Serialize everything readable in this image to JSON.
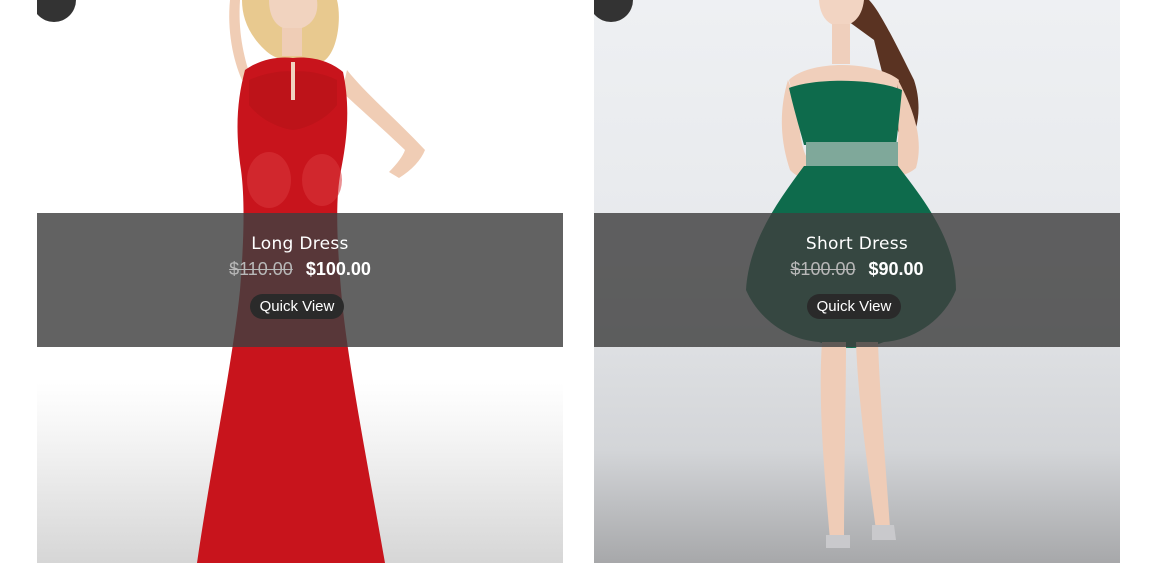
{
  "products": [
    {
      "name": "Long Dress",
      "old_price": "$110.00",
      "price": "$100.00",
      "quick_view_label": "Quick View",
      "dress_color": "#c8141c"
    },
    {
      "name": "Short Dress",
      "old_price": "$100.00",
      "price": "$90.00",
      "quick_view_label": "Quick View",
      "dress_color": "#0e6b4c"
    }
  ],
  "colors": {
    "overlay": "#404040",
    "fav_circle": "#333333"
  }
}
